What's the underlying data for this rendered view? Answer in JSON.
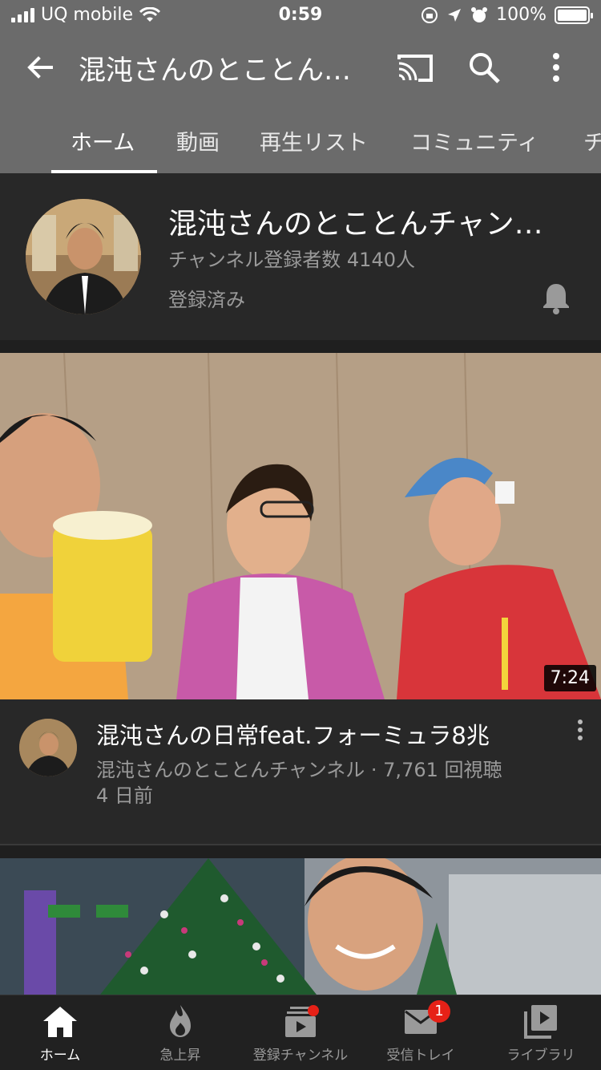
{
  "status_bar": {
    "carrier": "UQ mobile",
    "time": "0:59",
    "battery": "100%"
  },
  "app_bar": {
    "title": "混沌さんのとことん…"
  },
  "tabs": [
    {
      "label": "ホーム",
      "active": true
    },
    {
      "label": "動画"
    },
    {
      "label": "再生リスト"
    },
    {
      "label": "コミュニティ"
    },
    {
      "label": "チ"
    }
  ],
  "channel": {
    "name": "混沌さんのとことんチャン…",
    "subscribers": "チャンネル登録者数 4140人",
    "subscribed_label": "登録済み"
  },
  "videos": [
    {
      "duration": "7:24",
      "title": "混沌さんの日常feat.フォーミュラ8兆",
      "channel_views": "混沌さんのとことんチャンネル · 7,761 回視聴",
      "age": "4 日前"
    }
  ],
  "bottom_nav": [
    {
      "label": "ホーム",
      "icon": "home-icon",
      "active": true
    },
    {
      "label": "急上昇",
      "icon": "trending-icon"
    },
    {
      "label": "登録チャンネル",
      "icon": "subscriptions-icon",
      "dot": true
    },
    {
      "label": "受信トレイ",
      "icon": "inbox-icon",
      "badge": "1"
    },
    {
      "label": "ライブラリ",
      "icon": "library-icon"
    }
  ],
  "colors": {
    "header": "#6b6b6b",
    "background": "#1f1f1f",
    "card": "#282828",
    "accent_red": "#e62117"
  }
}
